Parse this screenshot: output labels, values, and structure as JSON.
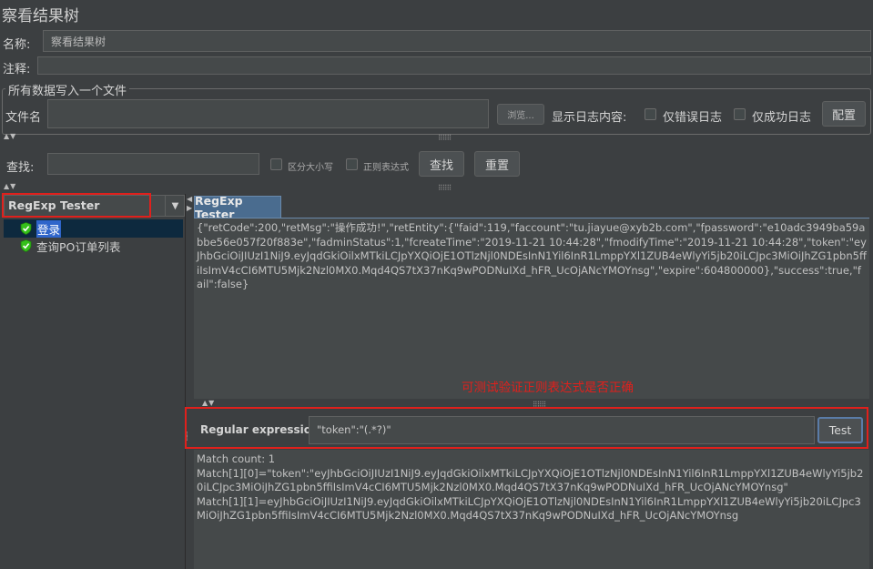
{
  "window": {
    "title": "察看结果树"
  },
  "name_row": {
    "label": "名称:",
    "value": "察看结果树"
  },
  "comment_row": {
    "label": "注释:",
    "value": ""
  },
  "file_group": {
    "legend": "所有数据写入一个文件",
    "filename_label": "文件名",
    "filename_value": "",
    "browse_label": "浏览...",
    "log_label": "显示日志内容:",
    "errors_only_label": "仅错误日志",
    "success_only_label": "仅成功日志",
    "config_label": "配置"
  },
  "search": {
    "label": "查找:",
    "value": "",
    "case_label": "区分大小写",
    "regex_label": "正则表达式",
    "find_label": "查找",
    "reset_label": "重置"
  },
  "renderer": {
    "selected": "RegExp Tester"
  },
  "tree": {
    "items": [
      {
        "label": "登录",
        "selected": true
      },
      {
        "label": "查询PO订单列表",
        "selected": false
      }
    ]
  },
  "tab": {
    "label": "RegExp Tester"
  },
  "response": {
    "text": "{\"retCode\":200,\"retMsg\":\"操作成功!\",\"retEntity\":{\"faid\":119,\"faccount\":\"tu.jiayue@xyb2b.com\",\"fpassword\":\"e10adc3949ba59abbe56e057f20f883e\",\"fadminStatus\":1,\"fcreateTime\":\"2019-11-21 10:44:28\",\"fmodifyTime\":\"2019-11-21 10:44:28\",\"token\":\"eyJhbGciOiJIUzI1NiJ9.eyJqdGkiOilxMTkiLCJpYXQiOjE1OTlzNjl0NDEsInN1Yil6InR1LmppYXl1ZUB4eWlyYi5jb20iLCJpc3MiOiJhZG1pbn5ffiIsImV4cCI6MTU5Mjk2Nzl0MX0.Mqd4QS7tX37nKq9wPODNuIXd_hFR_UcOjANcYMOYnsg\",\"expire\":604800000},\"success\":true,\"fail\":false}"
  },
  "annotation": {
    "text": "可测试验证正则表达式是否正确"
  },
  "regex": {
    "label": "Regular expression:",
    "value": "\"token\":\"(.*?)\"",
    "test_label": "Test"
  },
  "result": {
    "line1": "Match count: 1",
    "line2": "Match[1][0]=\"token\":\"eyJhbGciOiJIUzI1NiJ9.eyJqdGkiOilxMTkiLCJpYXQiOjE1OTlzNjl0NDEsInN1Yil6InR1LmppYXl1ZUB4eWlyYi5jb20iLCJpc3MiOiJhZG1pbn5ffiIsImV4cCI6MTU5Mjk2Nzl0MX0.Mqd4QS7tX37nKq9wPODNuIXd_hFR_UcOjANcYMOYnsg\"",
    "line3": "Match[1][1]=eyJhbGciOiJIUzI1NiJ9.eyJqdGkiOilxMTkiLCJpYXQiOjE1OTlzNjl0NDEsInN1Yil6InR1LmppYXl1ZUB4eWlyYi5jb20iLCJpc3MiOiJhZG1pbn5ffiIsImV4cCI6MTU5Mjk2Nzl0MX0.Mqd4QS7tX37nKq9wPODNuIXd_hFR_UcOjANcYMOYnsg"
  },
  "colors": {
    "background": "#3c3f41",
    "panel": "#45494a",
    "highlight_box": "#e0201c",
    "annotation": "#e0201c",
    "selection": "#2f65ca",
    "pass_icon": "#34c01a"
  }
}
